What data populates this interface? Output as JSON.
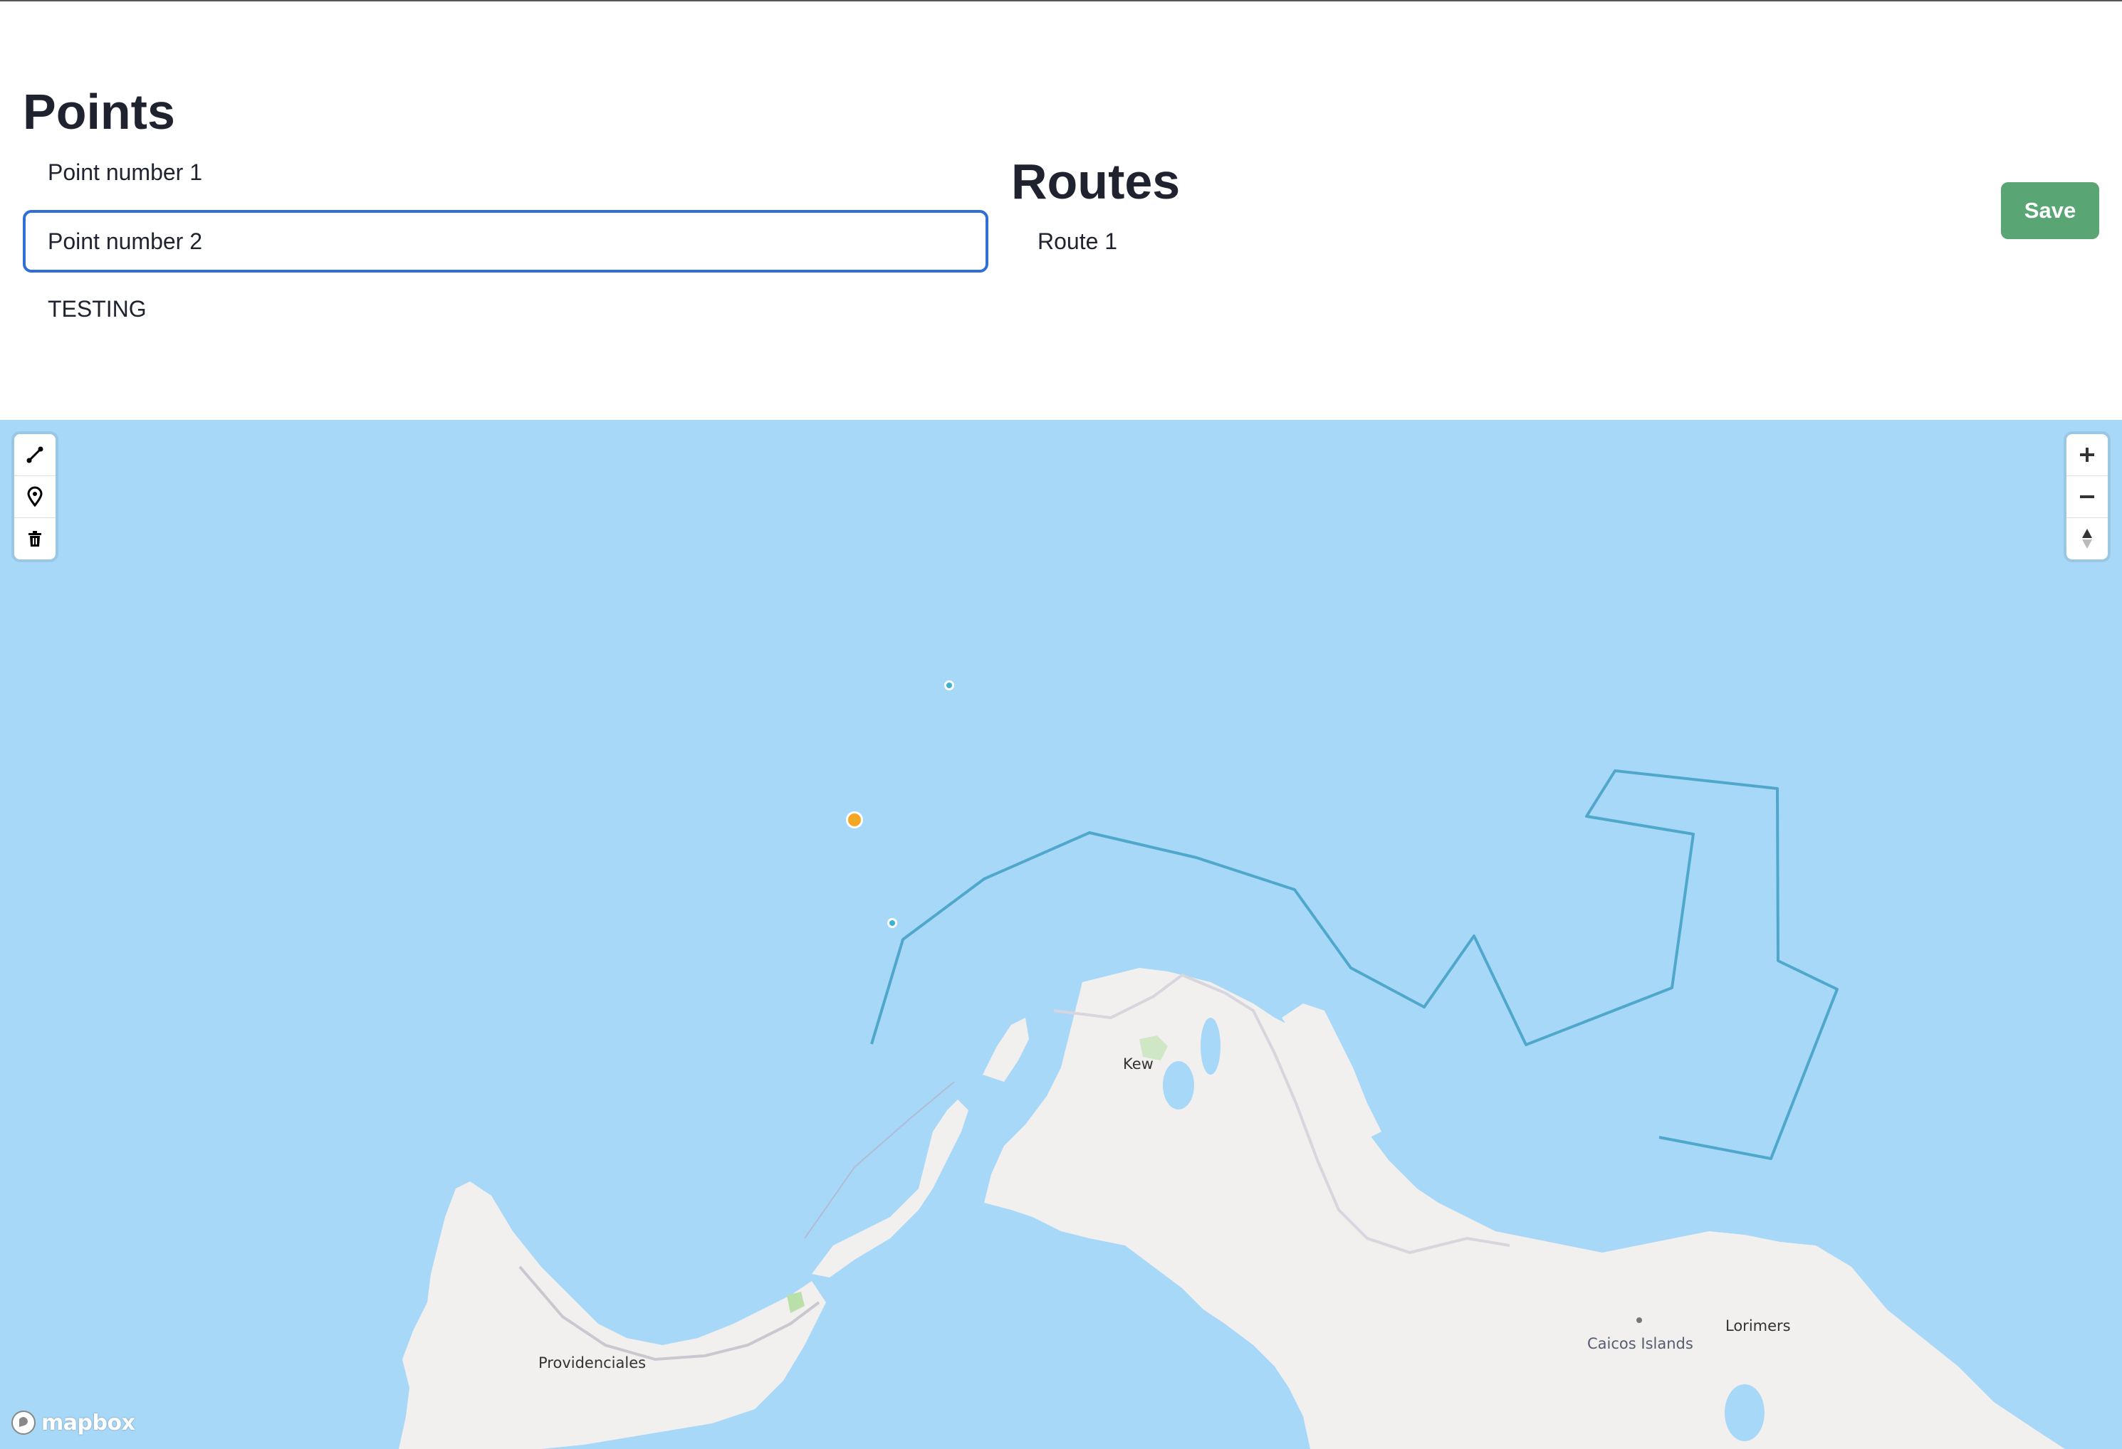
{
  "points": {
    "title": "Points",
    "items": [
      {
        "label": "Point number 1"
      },
      {
        "label": "Point number 2"
      },
      {
        "label": "TESTING"
      }
    ]
  },
  "routes": {
    "title": "Routes",
    "items": [
      {
        "label": "Route 1"
      }
    ]
  },
  "toolbar": {
    "save_label": "Save"
  },
  "map": {
    "labels": {
      "kew": "Kew",
      "providenciales": "Providenciales",
      "caicos_islands": "Caicos Islands",
      "lorimers": "Lorimers"
    },
    "attribution": "mapbox",
    "draw_controls": [
      "line-tool-icon",
      "marker-tool-icon",
      "trash-icon"
    ],
    "nav_controls": [
      "zoom-in-icon",
      "zoom-out-icon",
      "compass-icon"
    ],
    "colors": {
      "water": "#a8d8f8",
      "land": "#f2efef",
      "route_line": "#4fa8cc",
      "selected_point": "#f5a623",
      "point": "#3bb2d0",
      "save_button": "#5aa574",
      "selection_border": "#2f6fd6"
    }
  }
}
